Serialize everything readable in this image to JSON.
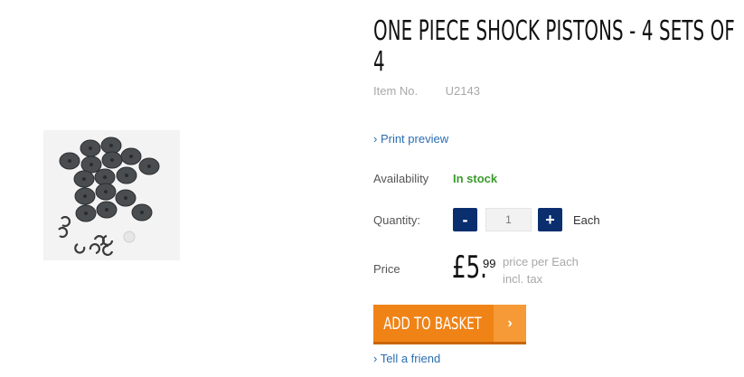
{
  "product": {
    "title": "ONE PIECE SHOCK PISTONS - 4 SETS OF 4",
    "item_no_label": "Item No.",
    "item_no_value": "U2143",
    "image_alt": "shock pistons and e-clips"
  },
  "links": {
    "print_preview": "› Print preview",
    "tell_friend": "› Tell a friend"
  },
  "availability": {
    "label": "Availability",
    "value": "In stock",
    "status_color": "#3a9a2c"
  },
  "quantity": {
    "label": "Quantity:",
    "minus_label": "-",
    "plus_label": "+",
    "value": "1",
    "unit": "Each"
  },
  "price": {
    "label": "Price",
    "main": "£5.",
    "cents": "99",
    "note_line1": "price per Each",
    "note_line2": "incl. tax"
  },
  "basket": {
    "label": "ADD TO BASKET",
    "arrow": "›",
    "color": "#f08316"
  },
  "colors": {
    "link": "#2a6db0",
    "qty_button": "#0a2e6e"
  }
}
